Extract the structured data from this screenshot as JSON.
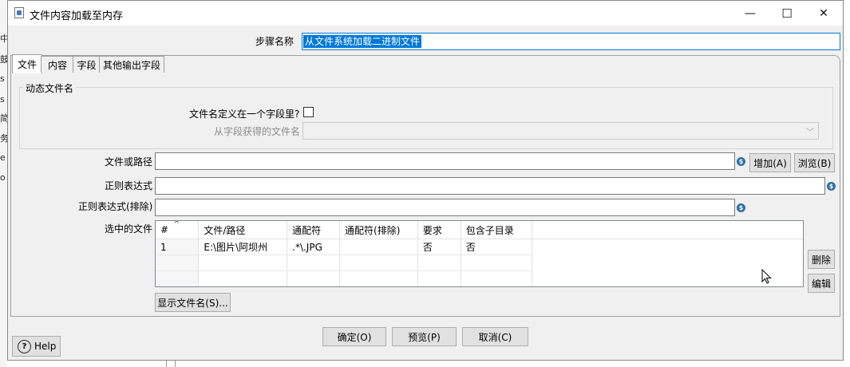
{
  "window": {
    "title": "文件内容加载至内存",
    "minimize": "—",
    "maximize": "☐",
    "close": "✕"
  },
  "background_fragments": [
    "中",
    "鼓",
    "s",
    "s",
    "简",
    "务",
    "e",
    "o"
  ],
  "step_name": {
    "label": "步骤名称",
    "value": "从文件系统加载二进制文件"
  },
  "tabs": [
    {
      "label": "文件",
      "active": true
    },
    {
      "label": "内容",
      "active": false
    },
    {
      "label": "字段",
      "active": false
    },
    {
      "label": "其他输出字段",
      "active": false
    }
  ],
  "dynamic_filename": {
    "group_title": "动态文件名",
    "checkbox_label": "文件名定义在一个字段里?",
    "checked": false,
    "field_label": "从字段获得的文件名",
    "field_value": ""
  },
  "file_path": {
    "label": "文件或路径",
    "value": "",
    "add_button": "增加(A)",
    "browse_button": "浏览(B)"
  },
  "regex": {
    "label": "正则表达式",
    "value": ""
  },
  "regex_exclude": {
    "label": "正则表达式(排除)",
    "value": ""
  },
  "selected_files": {
    "label": "选中的文件",
    "columns": [
      "#",
      "文件/路径",
      "通配符",
      "通配符(排除)",
      "要求",
      "包含子目录"
    ],
    "rows": [
      [
        "1",
        "E:\\图片\\阿坝州",
        ".*\\.JPG",
        "",
        "否",
        "否"
      ]
    ],
    "delete_button": "删除",
    "edit_button": "编辑",
    "show_filenames_button": "显示文件名(S)..."
  },
  "footer": {
    "ok": "确定(O)",
    "preview": "预览(P)",
    "cancel": "取消(C)",
    "help": "Help"
  },
  "variable_icon": "$"
}
